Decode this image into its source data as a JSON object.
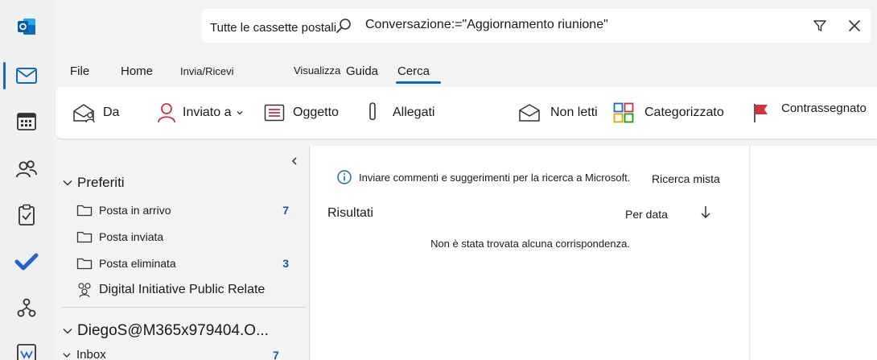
{
  "rail": {
    "items": [
      {
        "name": "app-logo-icon"
      },
      {
        "name": "mail-icon",
        "active": true
      },
      {
        "name": "calendar-icon"
      },
      {
        "name": "people-icon"
      },
      {
        "name": "tasks-icon"
      },
      {
        "name": "todo-icon"
      },
      {
        "name": "org-icon"
      },
      {
        "name": "calendar-app-icon"
      }
    ]
  },
  "search": {
    "scope": "Tutte le cassette postali",
    "query": "Conversazione:=\"Aggiornamento riunione\""
  },
  "menu": {
    "tabs": [
      "File",
      "Home",
      "Invia/Ricevi",
      "Visualizza",
      "Guida",
      "Cerca"
    ],
    "active": "Cerca"
  },
  "ribbon": {
    "from": "Da",
    "sent_to": "Inviato a",
    "subject": "Oggetto",
    "attachments": "Allegati",
    "unread": "Non letti",
    "categorized": "Categorizzato",
    "flagged": "Contrassegnato"
  },
  "folders": {
    "favorites_label": "Preferiti",
    "items": [
      {
        "label": "Posta in arrivo",
        "count": "7"
      },
      {
        "label": "Posta inviata",
        "count": ""
      },
      {
        "label": "Posta eliminata",
        "count": "3"
      },
      {
        "label": "Digital Initiative Public Relate",
        "count": ""
      }
    ],
    "account_label": "DiegoS@M365x979404.O...",
    "inbox_label": "Inbox",
    "inbox_count": "7"
  },
  "results": {
    "feedback": "Inviare commenti e suggerimenti per la ricerca a Microsoft.",
    "mixed": "Ricerca mista",
    "title": "Risultati",
    "sort": "Per data",
    "empty": "Non è stata trovata alcuna corrispondenza."
  },
  "colors": {
    "accent": "#0f6cbd",
    "count": "#0f5ba8",
    "flag": "#d13438",
    "person": "#c4314b"
  }
}
